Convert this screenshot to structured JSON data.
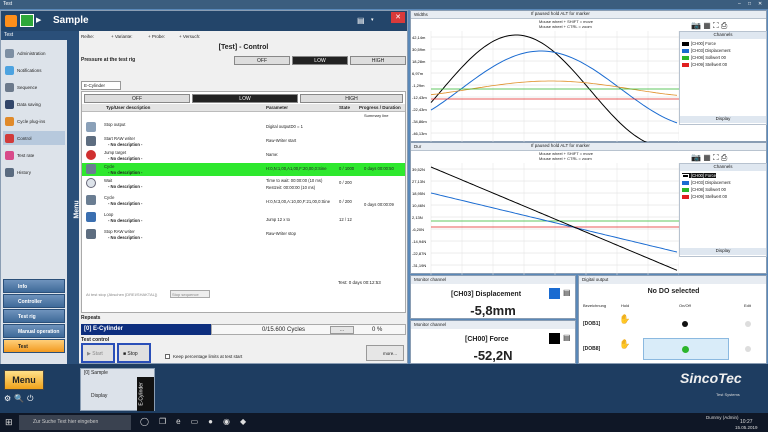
{
  "topbar": {
    "title": "Test",
    "wc_min": "–",
    "wc_max": "□",
    "wc_close": "✕"
  },
  "window": {
    "title": "Sample",
    "close": "✕"
  },
  "sidebar": {
    "header": "Test",
    "items": [
      {
        "label": "Administration"
      },
      {
        "label": "Notifications"
      },
      {
        "label": "Sequence"
      },
      {
        "label": "Data saving"
      },
      {
        "label": "Cycle plug-ins"
      },
      {
        "label": "Control"
      },
      {
        "label": "Test rate"
      },
      {
        "label": "History"
      }
    ],
    "groups": [
      {
        "label": "Info"
      },
      {
        "label": "Controller"
      },
      {
        "label": "Test rig"
      },
      {
        "label": "Manual operation"
      },
      {
        "label": "Test"
      }
    ],
    "menu_label": "Menu"
  },
  "content": {
    "toolbar": {
      "reihe": "Reihe:",
      "variante": "+ Variante:",
      "probe": "+ Probe:",
      "versuch": "+ Versuch:"
    },
    "panel_title": "[Test] - Control",
    "pressure_label": "Pressure at the test rig",
    "pressure_opts": [
      "OFF",
      "LOW",
      "HIGH"
    ],
    "tab": "E-Cylinder",
    "sub_opts": [
      "OFF",
      "LOW",
      "HIGH"
    ],
    "col_type": "Typ/User description",
    "col_param": "Parameter",
    "col_state": "State",
    "col_progress": "Progress / Duration",
    "summary": "Summary line",
    "rows": [
      {
        "t1": "Stop output",
        "t2": "",
        "p": "Digital outputD0 = 1",
        "s": "",
        "pr": ""
      },
      {
        "t1": "Start RAW writer",
        "t2": "- No description -",
        "p": "Raw-Writer start",
        "s": "",
        "pr": ""
      },
      {
        "t1": "Jump target",
        "t2": "- No description -",
        "p": "Name:",
        "s": "",
        "pr": ""
      },
      {
        "t1": "Cycle",
        "t2": "- No description -",
        "p": "H:0,N:1,00,A1,00,F:20,00,0:Sine",
        "s": "0 / 1000",
        "pr": "0 days 00:00:50"
      },
      {
        "t1": "Wait",
        "t2": "- No description -",
        "p": "Time to wait: 00:00:00 (10 ms)",
        "p2": "Restzeit: 00:00:00 (10 ms)",
        "s": "0 / 200",
        "pr": ""
      },
      {
        "t1": "Cycle",
        "t2": "- No description -",
        "p": "H:0,N:3,00,A:10,00,F:21,00,0:Sine",
        "s": "0 / 200",
        "pr": "0 days 00:00:09"
      },
      {
        "t1": "Loop",
        "t2": "- No description -",
        "p": "Jump 12 x to",
        "s": "12 / 12",
        "pr": ""
      },
      {
        "t1": "Stop RAW writer",
        "t2": "- No description -",
        "p": "Raw-Writer stop",
        "s": "",
        "pr": ""
      }
    ],
    "test_duration": "Test: 0 days 00:12:53",
    "at_test_stop": "At test stop (Abschen [DREI/SHAKTAL])",
    "at_test_stop_btn": "Stop sequence",
    "repeats_label": "Repeats",
    "repeat_name": "[0] E-Cylinder",
    "repeat_count": "0/15.600 Cycles",
    "repeat_pct": "0 %",
    "repeat_dots": "...",
    "test_control": "Test control",
    "start": "Start",
    "stop": "Stop",
    "keep_pct": "Keep percentage limits at test start",
    "more": "more..."
  },
  "chart1": {
    "title": "Widths",
    "hint1": "If paused hold ALT for marker",
    "hint2": "Mouse wheel + SHIFT = move",
    "hint3": "Mouse wheel + CTRL = zoom",
    "yticks": [
      "42,14m",
      "30,59m",
      "18,28m",
      "6,97m",
      "-1,29m",
      "-12,43m",
      "-22,43m",
      "-34,86m",
      "-46,13m"
    ],
    "channels_label": "Channels",
    "display_label": "Display",
    "channels": [
      {
        "name": "[CH00] Force",
        "color": "#000000"
      },
      {
        "name": "[CH03] Displacement",
        "color": "#1a6bd1"
      },
      {
        "name": "[CH08] Sollwert 00",
        "color": "#2cb52c"
      },
      {
        "name": "[CH09] Stellwert 00",
        "color": "#e02020"
      }
    ]
  },
  "chart2": {
    "title": "Dur",
    "hint1": "If paused hold ALT for marker",
    "hint2": "Mouse wheel + SHIFT = move",
    "hint3": "Mouse wheel + CTRL = zoom",
    "yticks": [
      "39,52N",
      "27,13N",
      "18,95N",
      "10,46N",
      "2,13N",
      "-6,20N",
      "-14,94N",
      "-22,87N",
      "-31,19N"
    ],
    "channels_label": "Channels",
    "display_label": "Display",
    "channels": [
      {
        "name": "[CH00] Force",
        "color": "#000000"
      },
      {
        "name": "[CH03] Displacement",
        "color": "#1a6bd1"
      },
      {
        "name": "[CH08] Sollwert 00",
        "color": "#2cb52c"
      },
      {
        "name": "[CH09] Stellwert 00",
        "color": "#e02020"
      }
    ]
  },
  "monitor1": {
    "label": "Monitor channel",
    "channel": "[CH03] Displacement",
    "value": "-5,8mm"
  },
  "monitor2": {
    "label": "Monitor channel",
    "channel": "[CH00] Force",
    "value": "-52,2N"
  },
  "digital": {
    "title": "Digital output",
    "selected": "No DO selected",
    "col1": "Bezeichnung",
    "col2": "Hold",
    "col3": "On/Off",
    "col4": "Edit",
    "rows": [
      "[DOB1]",
      "[DOB8]"
    ]
  },
  "appbar": {
    "menu": "Menu",
    "sample": "[0] Sample",
    "display": "Display",
    "ecyl": "E-Cylinder",
    "logo": "SincoTec",
    "logo_sub": "Test Systems"
  },
  "taskbar": {
    "search": "Zur Suche Text hier eingeben",
    "user": "Dummy (Admin)",
    "time": "10:27",
    "date": "15.05.2019"
  }
}
